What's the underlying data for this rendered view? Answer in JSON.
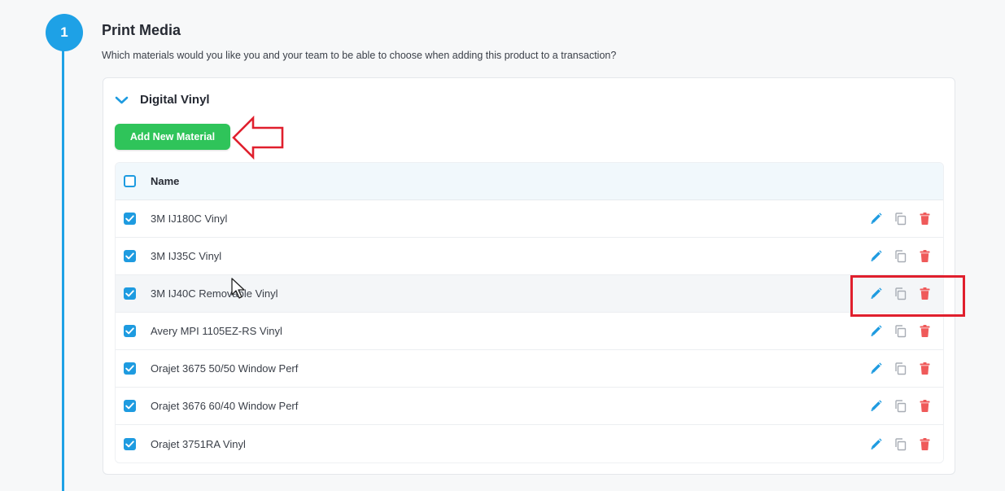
{
  "step": {
    "number": "1"
  },
  "section": {
    "title": "Print Media",
    "description": "Which materials would you like you and your team to be able to choose when adding this product to a transaction?"
  },
  "group": {
    "title": "Digital Vinyl",
    "add_button_label": "Add New Material"
  },
  "table": {
    "header_name": "Name",
    "rows": [
      {
        "name": "3M IJ180C Vinyl",
        "checked": true
      },
      {
        "name": "3M IJ35C Vinyl",
        "checked": true
      },
      {
        "name": "3M IJ40C Removable Vinyl",
        "checked": true
      },
      {
        "name": "Avery MPI 1105EZ-RS Vinyl",
        "checked": true
      },
      {
        "name": "Orajet 3675 50/50 Window Perf",
        "checked": true
      },
      {
        "name": "Orajet 3676 60/40 Window Perf",
        "checked": true
      },
      {
        "name": "Orajet 3751RA Vinyl",
        "checked": true
      }
    ]
  },
  "icons": {
    "edit": "pencil-icon",
    "duplicate": "copy-icon",
    "delete": "trash-icon",
    "expand": "chevron-down-icon"
  },
  "colors": {
    "accent": "#1ea1e6",
    "button_green": "#2fc45a",
    "delete_red": "#ef5a5a",
    "annotation_red": "#e01f2d"
  }
}
